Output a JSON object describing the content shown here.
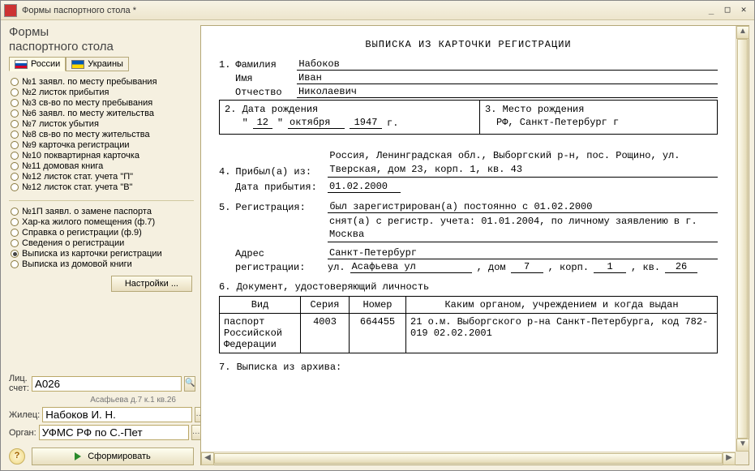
{
  "window": {
    "title": "Формы паспортного стола *"
  },
  "panel": {
    "title": "Формы",
    "subtitle": "паспортного стола"
  },
  "tabs": {
    "ru": "России",
    "ua": "Украины"
  },
  "forms_a": [
    "№1  заявл. по месту пребывания",
    "№2  листок прибытия",
    "№3  св-во по месту пребывания",
    "№6  заявл. по месту жительства",
    "№7  листок убытия",
    "№8  св-во по месту жительства",
    "№9  карточка регистрации",
    "№10 поквартирная карточка",
    "№11 домовая книга",
    "№12 листок стат. учета \"П\"",
    "№12 листок стат. учета \"В\""
  ],
  "forms_b": [
    "№1П  заявл. о замене паспорта",
    "Хар-ка жилого помещения (ф.7)",
    "Справка о регистрации (ф.9)",
    "Сведения о регистрации",
    "Выписка из карточки регистрации",
    "Выписка из домовой книги"
  ],
  "forms_b_selected_index": 4,
  "settings_btn": "Настройки ...",
  "fields": {
    "account_label": "Лиц. счет:",
    "account_value": "A026",
    "account_hint": "Асафьева д.7 к.1 кв.26",
    "tenant_label": "Жилец:",
    "tenant_value": "Набоков И. Н.",
    "agency_label": "Орган:",
    "agency_value": "УФМС РФ по С.-Пет"
  },
  "generate_btn": "Сформировать",
  "doc": {
    "title": "ВЫПИСКА ИЗ КАРТОЧКИ РЕГИСТРАЦИИ",
    "n1": "1.",
    "fam_label": "Фамилия",
    "fam": "Набоков",
    "name_label": "Имя",
    "name": "Иван",
    "patr_label": "Отчество",
    "patr": "Николаевич",
    "n2": "2.",
    "dob_label": "Дата рождения",
    "dob_day": "12",
    "dob_month": "октября",
    "dob_year": "1947",
    "dob_suffix": "г.",
    "n3": "3.",
    "pob_label": "Место рождения",
    "pob": "РФ, Санкт-Петербург г",
    "n4": "4.",
    "arrived_label": "Прибыл(а) из:",
    "arrived_from": "Россия, Ленинградская обл., Выборгский р-н, пос. Рощино, ул. Тверская, дом 23, корп. 1, кв. 43",
    "arrival_date_label": "Дата прибытия:",
    "arrival_date": "01.02.2000",
    "n5": "5.",
    "reg_label": "Регистрация:",
    "reg_line1": "был зарегистрирован(а) постоянно с 01.02.2000",
    "reg_line2": "снят(а) с регистр. учета: 01.01.2004, по личному заявлению в г. Москва",
    "addr_label1": "Адрес",
    "addr_label2": "регистрации:",
    "addr_city": "Санкт-Петербург",
    "addr_street_lbl": "ул.",
    "addr_street": "Асафьева ул",
    "addr_house_lbl": ", дом",
    "addr_house": "7",
    "addr_bld_lbl": ", корп.",
    "addr_bld": "1",
    "addr_flat_lbl": ", кв.",
    "addr_flat": "26",
    "n6": "6.",
    "id_doc_label": "Документ, удостоверяющий личность",
    "table_h1": "Вид",
    "table_h2": "Серия",
    "table_h3": "Номер",
    "table_h4": "Каким органом, учреждением и когда выдан",
    "table_type": "паспорт Российской Федерации",
    "table_series": "4003",
    "table_number": "664455",
    "table_issued": "21 о.м. Выборгского р-на Санкт-Петербурга, код 782-019 02.02.2001",
    "n7": "7.",
    "archive_label": "Выписка из архива:"
  }
}
